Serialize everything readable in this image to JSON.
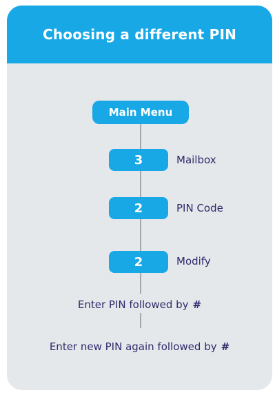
{
  "card": {
    "title": "Choosing a different PIN"
  },
  "flow": {
    "start": "Main Menu",
    "keys": [
      {
        "key": "3",
        "label": "Mailbox"
      },
      {
        "key": "2",
        "label": "PIN Code"
      },
      {
        "key": "2",
        "label": "Modify"
      }
    ],
    "steps": [
      {
        "text": "Enter PIN followed by",
        "symbol": "#"
      },
      {
        "text": "Enter new PIN again followed by",
        "symbol": "#"
      }
    ]
  },
  "colors": {
    "accent": "#18a8e6",
    "card_background": "#e5e8eb",
    "text": "#2e2a6b",
    "connector": "#a3a8ad"
  }
}
